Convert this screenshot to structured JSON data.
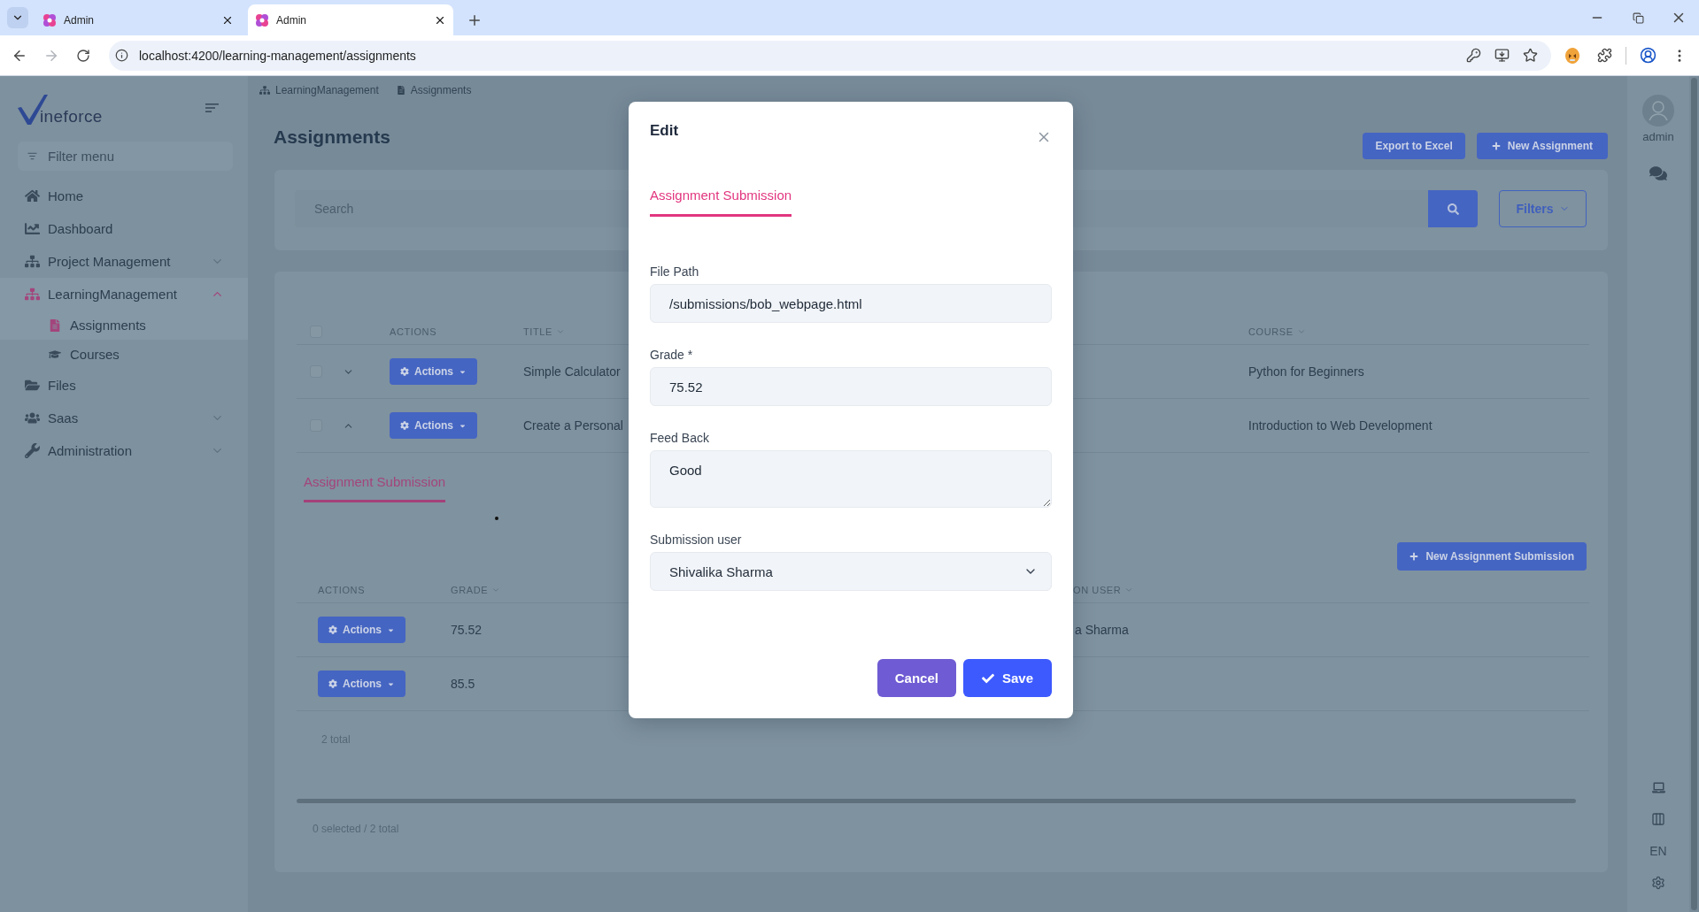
{
  "browser": {
    "tabs": [
      {
        "title": "Admin",
        "selected": false
      },
      {
        "title": "Admin",
        "selected": true
      }
    ],
    "url": "localhost:4200/learning-management/assignments"
  },
  "sidebar": {
    "logo_text": "ineforce",
    "filter": {
      "placeholder": "Filter menu"
    },
    "items": [
      {
        "kind": "link",
        "label": "Home",
        "selected": false
      },
      {
        "kind": "link",
        "label": "Dashboard",
        "selected": false
      },
      {
        "kind": "group",
        "label": "Project Management",
        "selected": false,
        "expanded": false
      },
      {
        "kind": "group",
        "label": "LearningManagement",
        "selected": false,
        "expanded": true,
        "children": [
          {
            "label": "Assignments",
            "selected": true
          },
          {
            "label": "Courses",
            "selected": false
          }
        ]
      },
      {
        "kind": "link",
        "label": "Files",
        "selected": false
      },
      {
        "kind": "group",
        "label": "Saas",
        "selected": false,
        "expanded": false
      },
      {
        "kind": "group",
        "label": "Administration",
        "selected": false,
        "expanded": false
      }
    ]
  },
  "breadcrumb": [
    "LearningManagement",
    "Assignments"
  ],
  "page_title": "Assignments",
  "header_buttons": [
    {
      "kind": "plain",
      "label": "Export to Excel"
    },
    {
      "kind": "add",
      "label": "New Assignment"
    }
  ],
  "search": {
    "placeholder": "Search",
    "filters_label": "Filters"
  },
  "table": {
    "all_checked": false,
    "columns": [
      {
        "label": "ACTIONS",
        "sortable": false
      },
      {
        "label": "TITLE",
        "sortable": true
      },
      {
        "label": "COURSE",
        "sortable": true
      }
    ],
    "rows": [
      {
        "checked": false,
        "expanded": false,
        "actions_label": "Actions",
        "title": "Simple Calculator",
        "course": "Python for Beginners"
      },
      {
        "checked": false,
        "expanded": true,
        "actions_label": "Actions",
        "title": "Create a Personal",
        "course": "Introduction to Web Development",
        "detail": {
          "tabs": [
            {
              "label": "Assignment Submission",
              "selected": true
            }
          ],
          "new_button": "New Assignment Submission",
          "columns": [
            {
              "label": "ACTIONS",
              "sortable": false
            },
            {
              "label": "GRADE",
              "sortable": true
            },
            {
              "label": "ON USER",
              "sortable": true
            }
          ],
          "rows": [
            {
              "actions_label": "Actions",
              "grade": "75.52",
              "user": "a Sharma"
            },
            {
              "actions_label": "Actions",
              "grade": "85.5"
            }
          ],
          "total": "2 total"
        }
      }
    ],
    "footer": "0 selected / 2 total"
  },
  "right_rail": {
    "user": "admin",
    "language": "EN"
  },
  "modal": {
    "title": "Edit",
    "tabs": [
      {
        "label": "Assignment Submission",
        "selected": true
      }
    ],
    "fields": [
      {
        "kind": "text",
        "label": "File Path",
        "value": "/submissions/bob_webpage.html"
      },
      {
        "kind": "text",
        "label": "Grade *",
        "value": "75.52"
      },
      {
        "kind": "textarea",
        "label": "Feed Back",
        "value": "Good"
      },
      {
        "kind": "select",
        "label": "Submission user",
        "value": "Shivalika Sharma"
      }
    ],
    "buttons": [
      {
        "kind": "secondary",
        "label": "Cancel"
      },
      {
        "kind": "primary",
        "label": "Save"
      }
    ]
  }
}
